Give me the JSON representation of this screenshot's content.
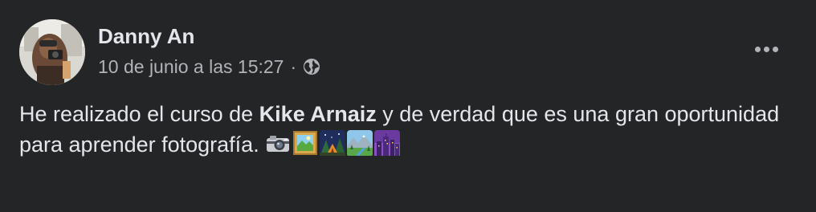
{
  "post": {
    "author": "Danny An",
    "date": "10 de junio a las 15:27",
    "separator": "·",
    "privacy_icon": "globe-icon",
    "menu_icon": "more-options-icon",
    "text_before": "He realizado el curso de ",
    "text_bold": "Kike Arnaiz",
    "text_after": " y de verdad que es una gran oportunidad para aprender fotografía. ",
    "emojis": [
      "camera-emoji",
      "framed-picture-emoji",
      "night-camping-emoji",
      "national-park-emoji",
      "night-city-emoji"
    ]
  },
  "colors": {
    "background": "#242526",
    "primary_text": "#e4e6eb",
    "secondary_text": "#b0b3b8"
  }
}
